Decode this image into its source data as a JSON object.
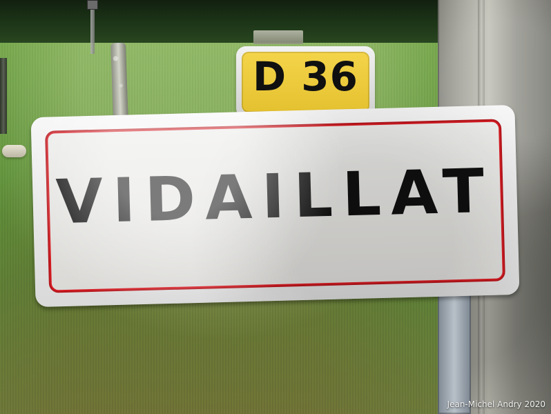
{
  "scene": {
    "road_plate": {
      "text": "D 36"
    },
    "town_sign": {
      "text": "VIDAILLAT"
    },
    "credit": {
      "text": "Jean-Michel Andry 2020"
    }
  }
}
